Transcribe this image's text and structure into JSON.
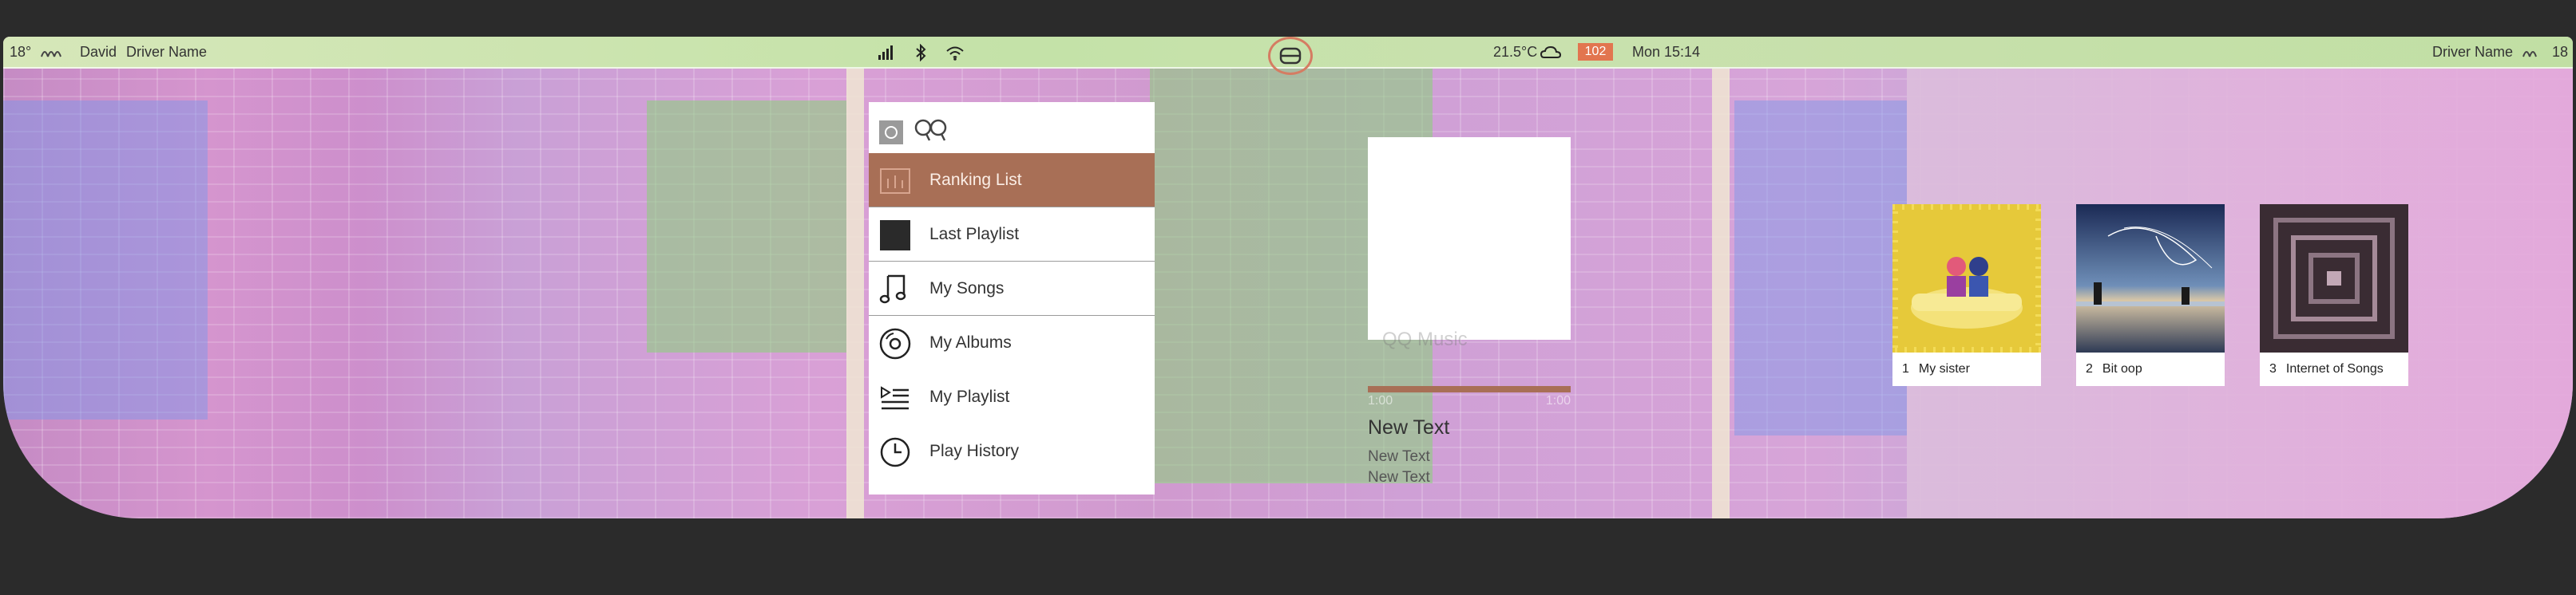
{
  "status_bar": {
    "left_temp": "18°",
    "left_user": "David",
    "left_driver": "Driver Name",
    "right_driver": "Driver Name",
    "right_temp": "18",
    "weather_temp": "21.5°C",
    "badge": "102",
    "date_time": "Mon 15:14"
  },
  "menu": {
    "header_logo_text": "QQ",
    "items": [
      {
        "label": "Ranking List",
        "icon": "bar-chart-icon",
        "active": true
      },
      {
        "label": "Last Playlist",
        "icon": "black-square-icon",
        "active": false
      },
      {
        "label": "My Songs",
        "icon": "music-note-icon",
        "active": false
      },
      {
        "label": "My Albums",
        "icon": "vinyl-disc-icon",
        "active": false
      },
      {
        "label": "My Playlist",
        "icon": "playlist-play-icon",
        "active": false
      },
      {
        "label": "Play History",
        "icon": "clock-icon",
        "active": false
      }
    ]
  },
  "now_playing": {
    "watermark": "QQ Music",
    "time_start": "1:00",
    "time_end": "1:00",
    "title": "New Text",
    "subtitle_1": "New Text",
    "subtitle_2": "New Text",
    "progress_fraction": 1.0
  },
  "albums": [
    {
      "index": "1",
      "title": "My sister",
      "cover": "yellow-bathtub-cover"
    },
    {
      "index": "2",
      "title": "Bit oop",
      "cover": "beach-sunset-cover"
    },
    {
      "index": "3",
      "title": "Internet of Songs",
      "cover": "abstract-pattern-cover"
    }
  ],
  "colors": {
    "accent": "#a86f56",
    "badge": "#e2754f",
    "panel": "#ffffff"
  }
}
